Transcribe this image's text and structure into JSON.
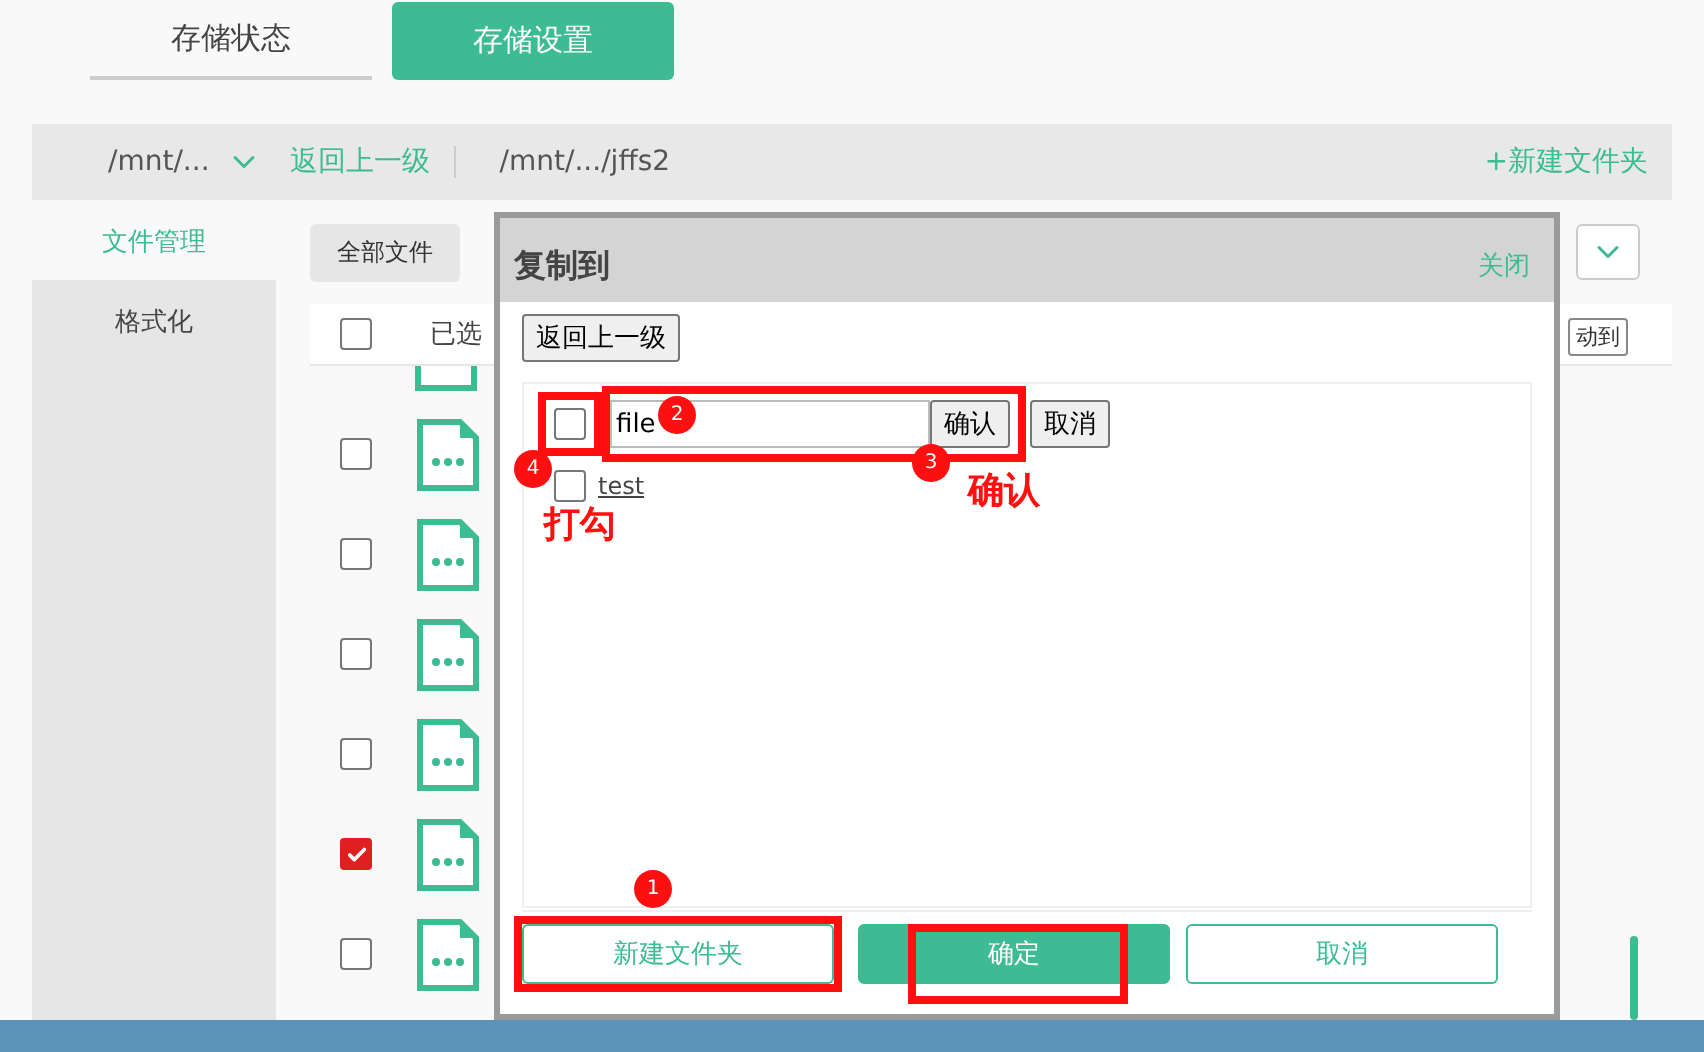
{
  "tabs": [
    {
      "label": "存储状态",
      "selected": false
    },
    {
      "label": "存储设置",
      "selected": true
    }
  ],
  "path_bar": {
    "dropdown": "/mnt/...",
    "back": "返回上一级",
    "path": "/mnt/.../jffs2",
    "new_folder": "+新建文件夹"
  },
  "sidebar": {
    "items": [
      {
        "label": "文件管理",
        "selected": true
      },
      {
        "label": "格式化",
        "selected": false
      }
    ]
  },
  "toolbar": {
    "filter": "全部文件"
  },
  "table_header": {
    "checked": false,
    "select_label": "已选",
    "move_button": "动到"
  },
  "rows": [
    {
      "checked": false
    },
    {
      "checked": false
    },
    {
      "checked": false
    },
    {
      "checked": false
    },
    {
      "checked": true
    },
    {
      "checked": false
    }
  ],
  "dialog": {
    "title": "复制到",
    "close": "关闭",
    "back": "返回上一级",
    "items": [
      {
        "kind": "input",
        "checked": false,
        "value": "file",
        "confirm": "确认",
        "cancel": "取消"
      },
      {
        "kind": "folder",
        "checked": false,
        "label": "test"
      }
    ],
    "buttons": [
      {
        "label": "新建文件夹",
        "kind": "outline"
      },
      {
        "label": "确定",
        "kind": "primary"
      },
      {
        "label": "取消",
        "kind": "outline"
      }
    ]
  },
  "annotations": [
    {
      "kind": "badge",
      "text": "2"
    },
    {
      "kind": "badge",
      "text": "3"
    },
    {
      "kind": "badge",
      "text": "4"
    },
    {
      "kind": "label",
      "text": "打勾"
    },
    {
      "kind": "label",
      "text": "确认"
    },
    {
      "kind": "badge",
      "text": "1"
    }
  ]
}
